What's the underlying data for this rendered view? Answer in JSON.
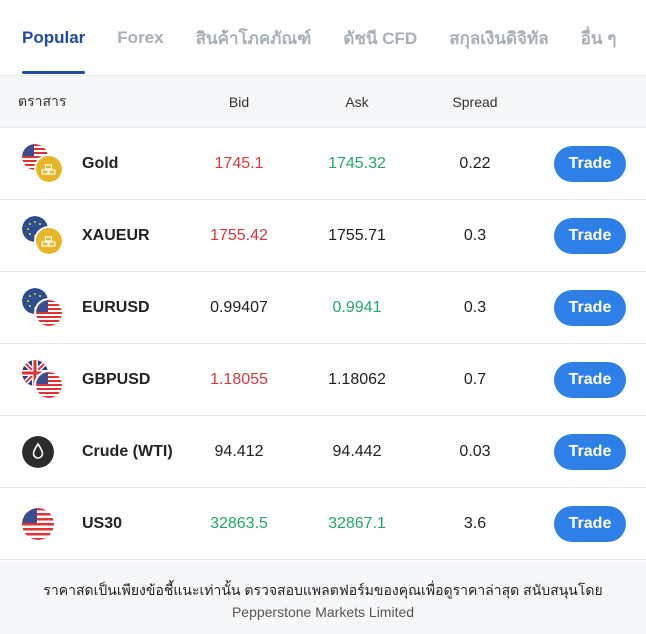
{
  "tabs": [
    {
      "label": "Popular",
      "active": true
    },
    {
      "label": "Forex",
      "active": false
    },
    {
      "label": "สินค้าโภคภัณฑ์",
      "active": false
    },
    {
      "label": "ดัชนี CFD",
      "active": false
    },
    {
      "label": "สกุลเงินดิจิทัล",
      "active": false
    },
    {
      "label": "อื่น ๆ",
      "active": false
    }
  ],
  "table": {
    "headers": {
      "instrument": "ตราสาร",
      "bid": "Bid",
      "ask": "Ask",
      "spread": "Spread"
    },
    "rows": [
      {
        "name": "Gold",
        "icon": "usd-gold-icon",
        "bid": "1745.1",
        "bid_color": "red",
        "ask": "1745.32",
        "ask_color": "green",
        "spread": "0.22",
        "trade": "Trade"
      },
      {
        "name": "XAUEUR",
        "icon": "eur-gold-icon",
        "bid": "1755.42",
        "bid_color": "red",
        "ask": "1755.71",
        "ask_color": "dark",
        "spread": "0.3",
        "trade": "Trade"
      },
      {
        "name": "EURUSD",
        "icon": "eur-usd-icon",
        "bid": "0.99407",
        "bid_color": "dark",
        "ask": "0.9941",
        "ask_color": "green",
        "spread": "0.3",
        "trade": "Trade"
      },
      {
        "name": "GBPUSD",
        "icon": "gbp-usd-icon",
        "bid": "1.18055",
        "bid_color": "red",
        "ask": "1.18062",
        "ask_color": "dark",
        "spread": "0.7",
        "trade": "Trade"
      },
      {
        "name": "Crude (WTI)",
        "icon": "oil-drop-icon",
        "bid": "94.412",
        "bid_color": "dark",
        "ask": "94.442",
        "ask_color": "dark",
        "spread": "0.03",
        "trade": "Trade"
      },
      {
        "name": "US30",
        "icon": "us-flag-icon",
        "bid": "32863.5",
        "bid_color": "green",
        "ask": "32867.1",
        "ask_color": "green",
        "spread": "3.6",
        "trade": "Trade"
      }
    ]
  },
  "footer": {
    "line1": "ราคาสดเป็นเพียงข้อชี้แนะเท่านั้น ตรวจสอบแพลตฟอร์มของคุณเพื่อดูราคาล่าสุด สนับสนุนโดย",
    "line2": "Pepperstone Markets Limited"
  },
  "colors": {
    "accent": "#1e4aa8",
    "button": "#2f7fe8",
    "red": "#d43a3a",
    "green": "#22a86a"
  }
}
